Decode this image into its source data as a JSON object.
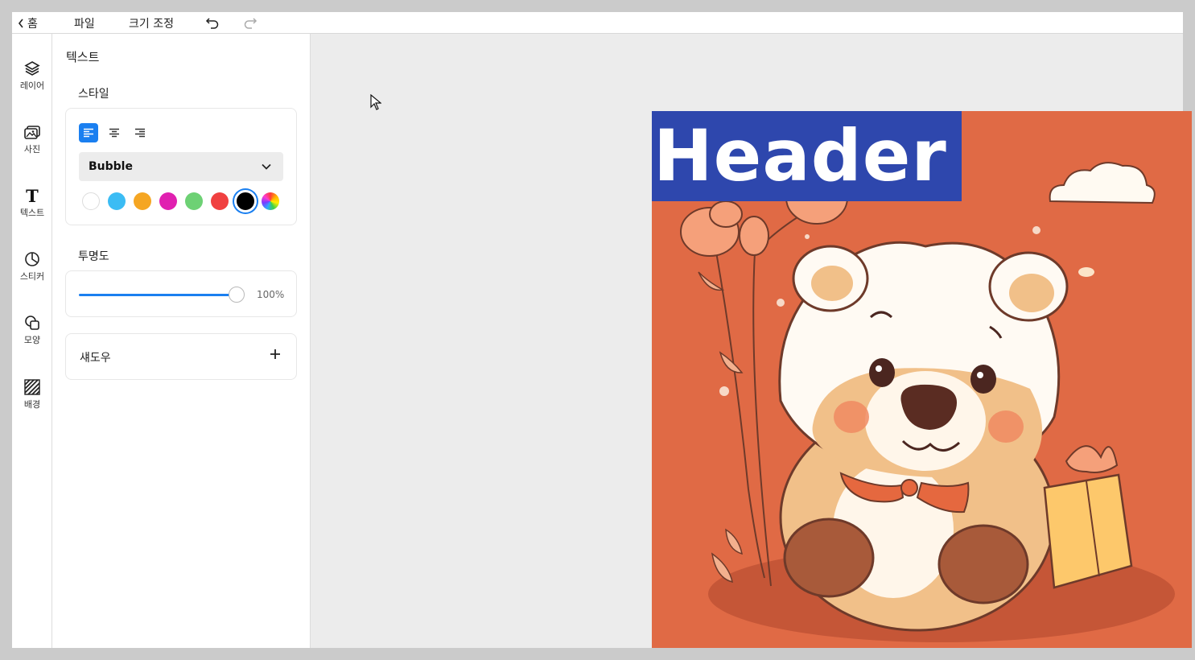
{
  "topbar": {
    "home_label": "홈",
    "file_label": "파일",
    "resize_label": "크기 조정",
    "undo_icon": "undo-icon",
    "redo_icon": "redo-icon"
  },
  "rail": {
    "items": [
      {
        "label": "레이어",
        "icon": "layers-icon"
      },
      {
        "label": "사진",
        "icon": "photo-icon"
      },
      {
        "label": "텍스트",
        "icon": "text-icon"
      },
      {
        "label": "스티커",
        "icon": "sticker-icon"
      },
      {
        "label": "모양",
        "icon": "shapes-icon"
      },
      {
        "label": "배경",
        "icon": "background-icon"
      }
    ]
  },
  "panel": {
    "title": "텍스트",
    "style_label": "스타일",
    "font_name": "Bubble",
    "alignments": [
      "left",
      "center",
      "right"
    ],
    "active_alignment": "left",
    "swatches": [
      "#ffffff",
      "#3bbcf4",
      "#f5a623",
      "#e020b0",
      "#6dd174",
      "#f04040",
      "#000000",
      "rainbow"
    ],
    "selected_swatch": "#000000",
    "opacity_label": "투명도",
    "opacity_value": "100%",
    "opacity_fraction": 1.0,
    "shadow_label": "섀도우"
  },
  "canvas": {
    "header_text": "Header",
    "background_color": "#e06a45",
    "header_box_color": "#2e47ad"
  }
}
